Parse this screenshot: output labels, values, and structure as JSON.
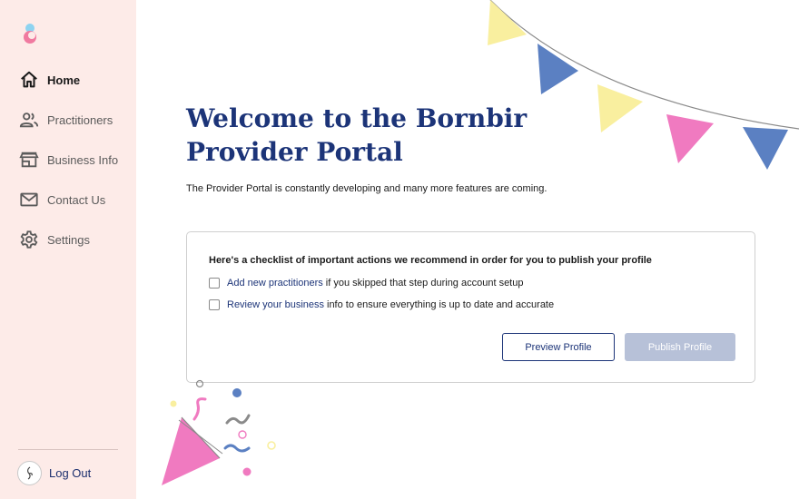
{
  "sidebar": {
    "items": [
      {
        "label": "Home",
        "icon": "home-icon",
        "active": true
      },
      {
        "label": "Practitioners",
        "icon": "people-icon",
        "active": false
      },
      {
        "label": "Business Info",
        "icon": "store-icon",
        "active": false
      },
      {
        "label": "Contact Us",
        "icon": "mail-icon",
        "active": false
      },
      {
        "label": "Settings",
        "icon": "gear-icon",
        "active": false
      }
    ],
    "logout_label": "Log Out"
  },
  "main": {
    "title": "Welcome to the Bornbir Provider Portal",
    "subtitle": "The Provider Portal is constantly developing and many more features are coming."
  },
  "checklist": {
    "heading": "Here's a checklist of important actions we recommend in order for you to publish your profile",
    "items": [
      {
        "link": "Add new practitioners",
        "text": "if you skipped that step during account setup",
        "checked": false
      },
      {
        "link": "Review your business",
        "text": "info to ensure everything is up to date and accurate",
        "checked": false
      }
    ],
    "preview_label": "Preview Profile",
    "publish_label": "Publish Profile"
  },
  "colors": {
    "sidebar_bg": "#fdebe8",
    "brand_navy": "#1c3478",
    "disabled_button": "#b7c1d8",
    "pennant_yellow": "#f9ef9f",
    "pennant_blue": "#5b80c2",
    "pennant_pink": "#f07ac0"
  }
}
